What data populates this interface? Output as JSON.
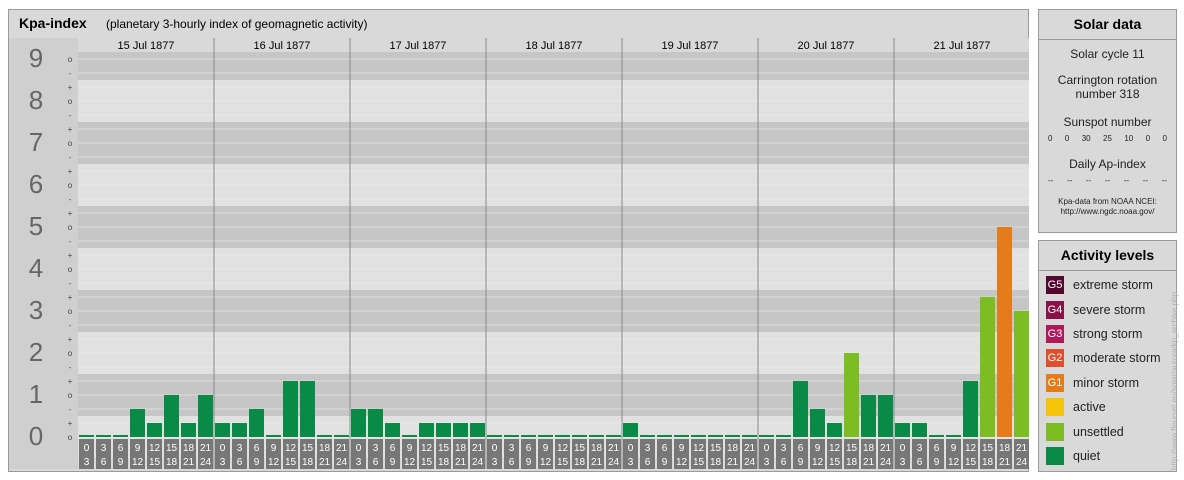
{
  "title": "Kpa-index",
  "subtitle": "(planetary 3-hourly index of geomagnetic activity)",
  "colors": {
    "panel_bg": "#d9d9d9",
    "band_dark": "#c6c6c6",
    "band_light": "#e1e1e1",
    "tick_bg": "#777777",
    "quiet": "#0a8a47",
    "unsettled": "#7dbd24",
    "active": "#f5c40a",
    "minor_storm": "#e57b19",
    "moderate_storm": "#e04e2c",
    "strong_storm": "#b0185c",
    "severe_storm": "#8a1247",
    "extreme_storm": "#55082e"
  },
  "chart_data": {
    "type": "bar",
    "title": "Kpa-index",
    "subtitle": "(planetary 3-hourly index of geomagnetic activity)",
    "ylim": [
      0,
      9
    ],
    "y_ticks": [
      "0",
      "1",
      "2",
      "3",
      "4",
      "5",
      "6",
      "7",
      "8",
      "9"
    ],
    "minor_labels": [
      "+",
      "o",
      "-"
    ],
    "days": [
      "15 Jul 1877",
      "16 Jul 1877",
      "17 Jul 1877",
      "18 Jul 1877",
      "19 Jul 1877",
      "20 Jul 1877",
      "21 Jul 1877"
    ],
    "interval_top": [
      "0",
      "3",
      "6",
      "9",
      "12",
      "15",
      "18",
      "21"
    ],
    "interval_bottom": [
      "3",
      "6",
      "9",
      "12",
      "15",
      "18",
      "21",
      "24"
    ],
    "values": [
      [
        0,
        0,
        0,
        0.667,
        0.333,
        1,
        0.333,
        1
      ],
      [
        0.333,
        0.333,
        0.667,
        0,
        1.333,
        1.333,
        0,
        0
      ],
      [
        0.667,
        0.667,
        0.333,
        0,
        0.333,
        0.333,
        0.333,
        0.333
      ],
      [
        0,
        0,
        0,
        0,
        0,
        0,
        0,
        0
      ],
      [
        0.333,
        0,
        0,
        0,
        0,
        0,
        0,
        0
      ],
      [
        0,
        0,
        1.333,
        0.667,
        0.333,
        2,
        1,
        1
      ],
      [
        0.333,
        0.333,
        0,
        0,
        1.333,
        3.333,
        5,
        3
      ]
    ],
    "levels": [
      "quiet",
      "quiet",
      "quiet",
      "quiet",
      "quiet",
      "quiet",
      "quiet",
      "quiet",
      "quiet",
      "quiet",
      "quiet",
      "quiet",
      "quiet",
      "quiet",
      "quiet",
      "quiet",
      "quiet",
      "quiet",
      "quiet",
      "quiet",
      "quiet",
      "quiet",
      "quiet",
      "quiet",
      "quiet",
      "quiet",
      "quiet",
      "quiet",
      "quiet",
      "quiet",
      "quiet",
      "quiet",
      "quiet",
      "quiet",
      "quiet",
      "quiet",
      "quiet",
      "quiet",
      "quiet",
      "quiet",
      "quiet",
      "quiet",
      "quiet",
      "quiet",
      "quiet",
      "unsettled",
      "quiet",
      "quiet",
      "quiet",
      "quiet",
      "quiet",
      "quiet",
      "quiet",
      "unsettled",
      "minor_storm",
      "unsettled"
    ]
  },
  "solar_data": {
    "header": "Solar data",
    "cycle": "Solar cycle 11",
    "carrington_line1": "Carrington rotation",
    "carrington_line2": "number 318",
    "sunspot_label": "Sunspot number",
    "sunspot_values": [
      "0",
      "0",
      "30",
      "25",
      "10",
      "0",
      "0"
    ],
    "ap_label": "Daily Ap-index",
    "ap_values": [
      "--",
      "--",
      "--",
      "--",
      "--",
      "--",
      "--"
    ],
    "source_line1": "Kpa-data from NOAA NCEI:",
    "source_line2": "http://www.ngdc.noaa.gov/"
  },
  "activity_levels": {
    "header": "Activity levels",
    "items": [
      {
        "code": "G5",
        "label": "extreme storm",
        "color": "#55082e"
      },
      {
        "code": "G4",
        "label": "severe storm",
        "color": "#8a1247"
      },
      {
        "code": "G3",
        "label": "strong storm",
        "color": "#b0185c"
      },
      {
        "code": "G2",
        "label": "moderate storm",
        "color": "#e04e2c"
      },
      {
        "code": "G1",
        "label": "minor storm",
        "color": "#e57b19"
      },
      {
        "code": "",
        "label": "active",
        "color": "#f5c40a"
      },
      {
        "code": "",
        "label": "unsettled",
        "color": "#7dbd24"
      },
      {
        "code": "",
        "label": "quiet",
        "color": "#0a8a47"
      }
    ]
  },
  "watermark": "http://www.fleurset.eu/solar/aurora/kp_archive.php"
}
